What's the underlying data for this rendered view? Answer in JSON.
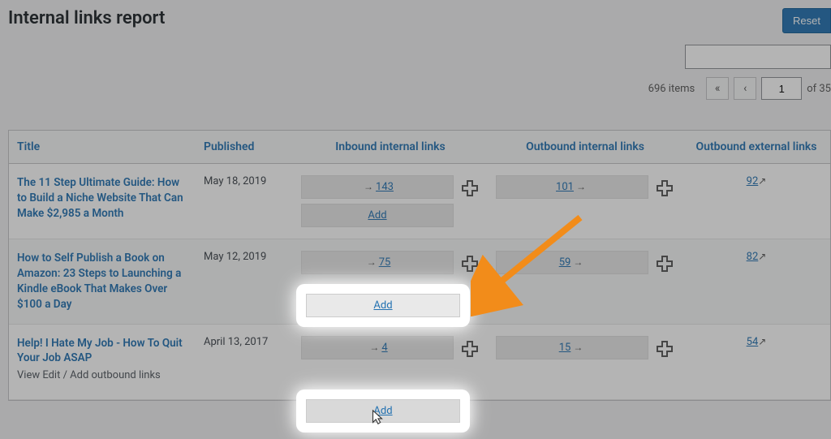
{
  "page": {
    "title": "Internal links report",
    "reset_button": "Reset"
  },
  "pagination": {
    "items_count": "696 items",
    "current_page": "1",
    "total_pages": "of 35"
  },
  "columns": {
    "title": "Title",
    "published": "Published",
    "inbound": "Inbound internal links",
    "outbound_internal": "Outbound internal links",
    "outbound_external": "Outbound external links"
  },
  "rows": [
    {
      "title": "The 11 Step Ultimate Guide: How to Build a Niche Website That Can Make $2,985 a Month",
      "published": "May 18, 2019",
      "inbound": "143",
      "outbound_internal": "101",
      "outbound_external": "92",
      "add_label": "Add"
    },
    {
      "title": "How to Self Publish a Book on Amazon: 23 Steps to Launching a Kindle eBook That Makes Over $100 a Day",
      "published": "May 12, 2019",
      "inbound": "75",
      "outbound_internal": "59",
      "outbound_external": "82",
      "add_label": "Add"
    },
    {
      "title": "Help! I Hate My Job - How To Quit Your Job ASAP",
      "published": "April 13, 2017",
      "inbound": "4",
      "outbound_internal": "15",
      "outbound_external": "54",
      "add_label": "Add",
      "row_actions": "View   Edit / Add outbound links"
    }
  ]
}
